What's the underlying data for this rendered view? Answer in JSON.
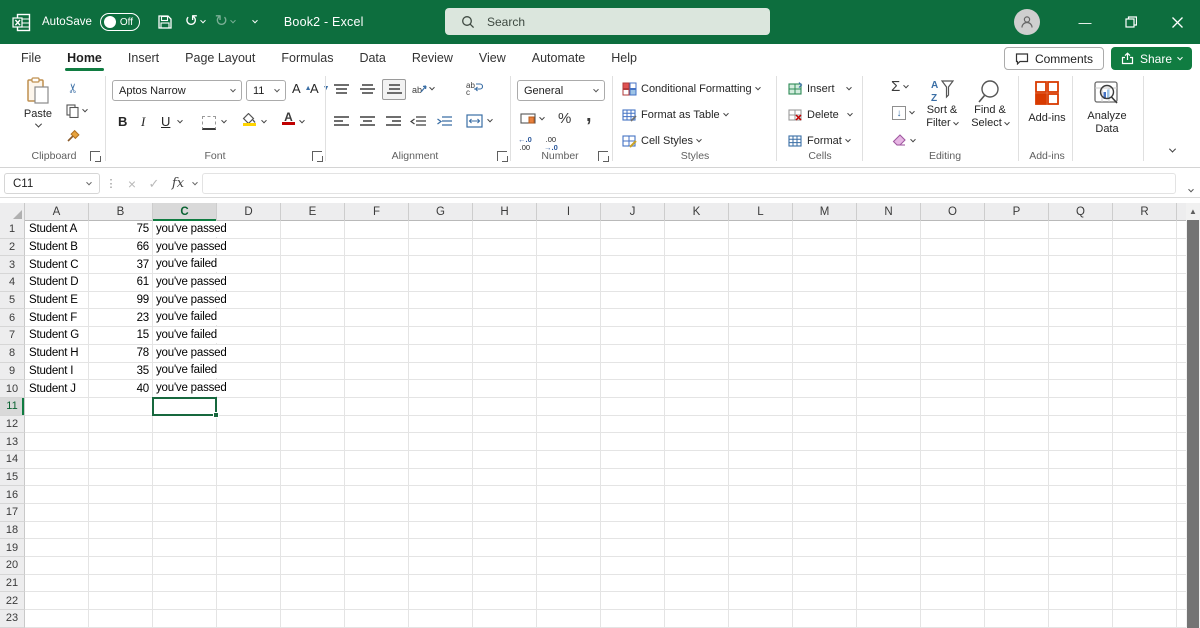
{
  "title_bar": {
    "autosave_label": "AutoSave",
    "autosave_state": "Off",
    "doc_title": "Book2 - Excel",
    "search_placeholder": "Search"
  },
  "tabs": {
    "active": "Home",
    "items": [
      {
        "label": "File"
      },
      {
        "label": "Home"
      },
      {
        "label": "Insert"
      },
      {
        "label": "Page Layout"
      },
      {
        "label": "Formulas"
      },
      {
        "label": "Data"
      },
      {
        "label": "Review"
      },
      {
        "label": "View"
      },
      {
        "label": "Automate"
      },
      {
        "label": "Help"
      }
    ]
  },
  "actions": {
    "comments": "Comments",
    "share": "Share"
  },
  "ribbon": {
    "clipboard": {
      "label": "Clipboard",
      "paste": "Paste"
    },
    "font": {
      "label": "Font",
      "font_name": "Aptos Narrow",
      "font_size": "11",
      "bold": "B",
      "italic": "I",
      "underline": "U"
    },
    "alignment": {
      "label": "Alignment"
    },
    "number": {
      "label": "Number",
      "format": "General",
      "percent": "%",
      "comma": ",",
      "inc_top": "←.0",
      "inc_bot": ".00",
      "dec_top": ".00",
      "dec_bot": "→.0"
    },
    "styles": {
      "label": "Styles",
      "conditional": "Conditional Formatting",
      "format_table": "Format as Table",
      "cell_styles": "Cell Styles"
    },
    "cells": {
      "label": "Cells",
      "insert": "Insert",
      "delete": "Delete",
      "format": "Format"
    },
    "editing": {
      "label": "Editing",
      "autosum": "Σ",
      "sort_line1": "Sort &",
      "sort_line2": "Filter",
      "find_line1": "Find &",
      "find_line2": "Select",
      "sort_a": "A",
      "sort_z": "Z"
    },
    "addins": {
      "label": "Add-ins",
      "button": "Add-ins"
    },
    "analyze": {
      "line1": "Analyze",
      "line2": "Data"
    }
  },
  "formula_bar": {
    "name_box": "C11",
    "cancel": "×",
    "enter": "✓",
    "fx": "fx"
  },
  "grid": {
    "columns": [
      "A",
      "B",
      "C",
      "D",
      "E",
      "F",
      "G",
      "H",
      "I",
      "J",
      "K",
      "L",
      "M",
      "N",
      "O",
      "P",
      "Q",
      "R"
    ],
    "row_count": 23,
    "active_cell": {
      "col": "C",
      "row": 11
    },
    "rows": [
      {
        "row": 1,
        "a": "Student A",
        "b": "75",
        "c": "you've passed"
      },
      {
        "row": 2,
        "a": "Student B",
        "b": "66",
        "c": "you've passed"
      },
      {
        "row": 3,
        "a": "Student C",
        "b": "37",
        "c": "you've failed"
      },
      {
        "row": 4,
        "a": "Student D",
        "b": "61",
        "c": "you've passed"
      },
      {
        "row": 5,
        "a": "Student E",
        "b": "99",
        "c": "you've passed"
      },
      {
        "row": 6,
        "a": "Student F",
        "b": "23",
        "c": "you've failed"
      },
      {
        "row": 7,
        "a": "Student G",
        "b": "15",
        "c": "you've failed"
      },
      {
        "row": 8,
        "a": "Student H",
        "b": "78",
        "c": "you've passed"
      },
      {
        "row": 9,
        "a": "Student I",
        "b": "35",
        "c": "you've failed"
      },
      {
        "row": 10,
        "a": "Student J",
        "b": "40",
        "c": "you've passed"
      }
    ]
  },
  "icons": {
    "undo": "↺",
    "redo": "↻",
    "scissors": "✂",
    "dots": "⋮",
    "minimize": "—",
    "scroll_up": "▲",
    "fill_down": "↓",
    "sum": "Σ"
  },
  "colors": {
    "brand_green": "#0d6e3e",
    "accent_green": "#107c41",
    "selection_border": "#17683e"
  }
}
